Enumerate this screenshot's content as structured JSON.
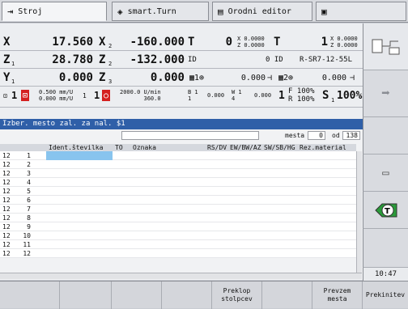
{
  "tabs": [
    {
      "label": "Stroj"
    },
    {
      "label": "smart.Turn"
    },
    {
      "label": "Orodni editor"
    },
    {
      "label": ""
    }
  ],
  "dro": {
    "row1": {
      "axis": "X",
      "sub": "",
      "value": "17.560",
      "axis2": "X",
      "sub2": "2",
      "value2": "-160.000",
      "tlabel": "T",
      "tnum": "0",
      "xs": "X 0.0000",
      "zs": "Z 0.0000",
      "t2": "T",
      "num2": "1",
      "xs2": "X 0.0000",
      "zs2": "Z 0.0000"
    },
    "row2": {
      "axis": "Z",
      "sub": "1",
      "value": "28.780",
      "axis2": "Z",
      "sub2": "2",
      "value2": "-132.000",
      "id1": "ID",
      "id2": "0 ID",
      "tool": "R-SR7-12-55L"
    },
    "row3": {
      "axis": "Y",
      "sub": "1",
      "value": "0.000",
      "axis2": "Z",
      "sub2": "3",
      "value2": "0.000",
      "v1": "0.000",
      "v2": "0.000"
    },
    "row4": {
      "spindle_num": "1",
      "feed1": "0.500 mm/U",
      "feed2": "0.000 mm/U",
      "one": "1",
      "one2": "1",
      "speed1": "2000.0 U/min",
      "speed2": "360.0",
      "b1": "B 1",
      "b1b": "1",
      "bval": "0.000",
      "w1": "W 1",
      "w4": "4",
      "wval": "0.000",
      "f1": "1",
      "f": "F 100%",
      "r": "R 100%",
      "s": "S",
      "s1": "1",
      "spct": "100%"
    }
  },
  "status": "Izber. mesto zal. za nal. $1",
  "toolbar": {
    "mesta_label": "mesta",
    "mesta_val": "0",
    "od_label": "od",
    "od_val": "138"
  },
  "columns": [
    "Ident.številka",
    "TO",
    "Oznaka",
    "RS/DV",
    "EW/BW/AZ",
    "SW/SB/HG",
    "Rez.material"
  ],
  "rows": [
    {
      "a": "12",
      "b": "1"
    },
    {
      "a": "12",
      "b": "2"
    },
    {
      "a": "12",
      "b": "3"
    },
    {
      "a": "12",
      "b": "4"
    },
    {
      "a": "12",
      "b": "5"
    },
    {
      "a": "12",
      "b": "6"
    },
    {
      "a": "12",
      "b": "7"
    },
    {
      "a": "12",
      "b": "8"
    },
    {
      "a": "12",
      "b": "9"
    },
    {
      "a": "12",
      "b": "10"
    },
    {
      "a": "12",
      "b": "11"
    },
    {
      "a": "12",
      "b": "12"
    }
  ],
  "clock": "10:47",
  "softkeys": [
    "",
    "",
    "",
    "",
    "Preklop\nstolpcev",
    "",
    "Prevzem\nmesta",
    "Prekinitev"
  ]
}
